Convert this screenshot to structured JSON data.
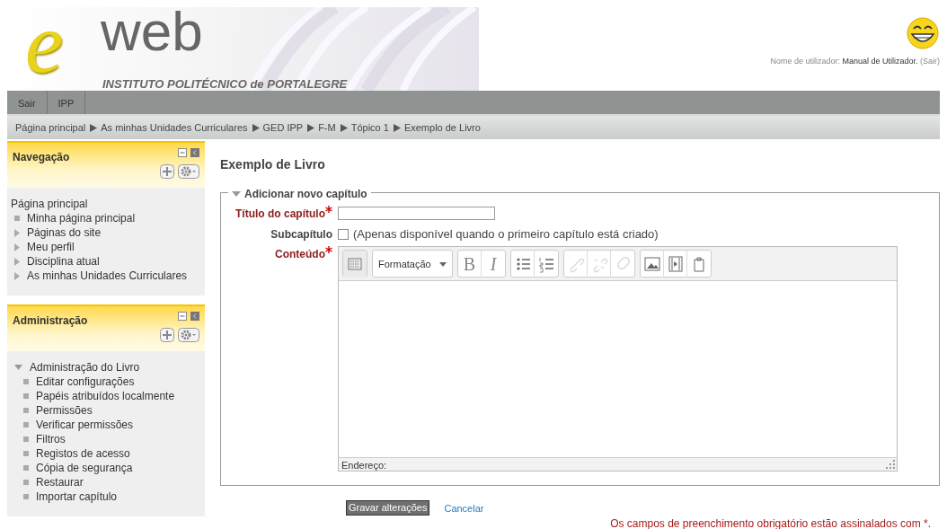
{
  "header": {
    "logo": {
      "letter": "e",
      "word": "web",
      "institution": "INSTITUTO POLITÉCNICO de PORTALEGRE"
    },
    "user": {
      "prefix": "Nome de utilizador:",
      "name": "Manual de Utilizador.",
      "logout": "(Sair)"
    }
  },
  "menu": [
    {
      "label": "Sair"
    },
    {
      "label": "IPP"
    }
  ],
  "breadcrumb": [
    {
      "label": "Página principal"
    },
    {
      "label": "As minhas Unidades Curriculares"
    },
    {
      "label": "GED IPP"
    },
    {
      "label": "F-M"
    },
    {
      "label": "Tópico 1"
    },
    {
      "label": "Exemplo de Livro"
    }
  ],
  "sidebar": [
    {
      "title": "Navegação",
      "items": [
        {
          "label": "Página principal",
          "kind": "root",
          "children": [
            {
              "label": "Minha página principal",
              "kind": "leaf"
            },
            {
              "label": "Páginas do site",
              "kind": "branch",
              "expanded": false
            },
            {
              "label": "Meu perfil",
              "kind": "branch",
              "expanded": false
            },
            {
              "label": "Disciplina atual",
              "kind": "branch",
              "expanded": false
            },
            {
              "label": "As minhas Unidades Curriculares",
              "kind": "branch",
              "expanded": false
            }
          ]
        }
      ]
    },
    {
      "title": "Administração",
      "items": [
        {
          "label": "Administração do Livro",
          "kind": "branch",
          "expanded": true,
          "children": [
            {
              "label": "Editar configurações",
              "kind": "leaf"
            },
            {
              "label": "Papéis atribuídos localmente",
              "kind": "leaf"
            },
            {
              "label": "Permissões",
              "kind": "leaf"
            },
            {
              "label": "Verificar permissões",
              "kind": "leaf"
            },
            {
              "label": "Filtros",
              "kind": "leaf"
            },
            {
              "label": "Registos de acesso",
              "kind": "leaf"
            },
            {
              "label": "Cópia de segurança",
              "kind": "leaf"
            },
            {
              "label": "Restaurar",
              "kind": "leaf"
            },
            {
              "label": "Importar capítulo",
              "kind": "leaf"
            }
          ]
        }
      ]
    }
  ],
  "page_title": "Exemplo de Livro",
  "form": {
    "legend": "Adicionar novo capítulo",
    "expanded": true,
    "title_field": {
      "label": "Título do capítulo",
      "required": true
    },
    "subchapter": {
      "label": "Subcapítulo",
      "checked": false,
      "note": "(Apenas disponível quando o primeiro capítulo está criado)"
    },
    "content": {
      "label": "Conteúdo",
      "required": true,
      "toolbar": [
        [
          {
            "kind": "icon",
            "disabled": false
          }
        ],
        [
          {
            "kind": "dropdown",
            "label": "Formatação"
          }
        ],
        [
          {
            "kind": "text",
            "label": "B"
          },
          {
            "kind": "text",
            "label": "I"
          }
        ],
        [
          {
            "kind": "icon",
            "disabled": false
          },
          {
            "kind": "icon",
            "disabled": false
          }
        ],
        [
          {
            "kind": "icon",
            "disabled": true
          },
          {
            "kind": "icon",
            "disabled": true
          },
          {
            "kind": "icon",
            "disabled": true
          }
        ],
        [
          {
            "kind": "icon",
            "disabled": false
          },
          {
            "kind": "icon",
            "disabled": false
          },
          {
            "kind": "icon",
            "disabled": false
          }
        ]
      ],
      "status": "Endereço:"
    }
  },
  "buttons": {
    "save": "Gravar alterações",
    "cancel": "Cancelar"
  },
  "required_note": "Os campos de preenchimento obrigatório estão assinalados com *."
}
